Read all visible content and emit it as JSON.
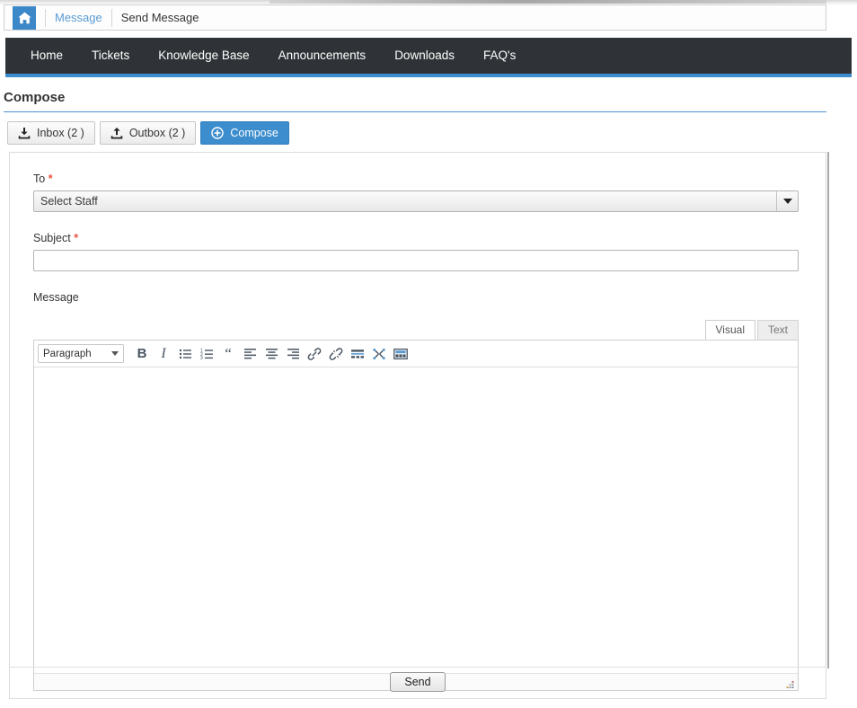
{
  "breadcrumb": {
    "home_icon": "home-icon",
    "link_label": "Message",
    "current_label": "Send Message"
  },
  "nav": {
    "items": [
      {
        "label": "Home"
      },
      {
        "label": "Tickets"
      },
      {
        "label": "Knowledge Base"
      },
      {
        "label": "Announcements"
      },
      {
        "label": "Downloads"
      },
      {
        "label": "FAQ's"
      }
    ],
    "background": "#2f3337",
    "accent": "#3c8dcd"
  },
  "page": {
    "title": "Compose"
  },
  "tabs": [
    {
      "label": "Inbox (2 )",
      "icon": "inbox-download-icon",
      "active": false
    },
    {
      "label": "Outbox (2 )",
      "icon": "outbox-upload-icon",
      "active": false
    },
    {
      "label": "Compose",
      "icon": "plus-circle-icon",
      "active": true
    }
  ],
  "form": {
    "to": {
      "label": "To",
      "required_mark": "*",
      "selected_option": "Select Staff",
      "options": [
        "Select Staff"
      ]
    },
    "subject": {
      "label": "Subject",
      "required_mark": "*",
      "value": "",
      "placeholder": ""
    },
    "message": {
      "label": "Message",
      "value": "",
      "editor_tabs": [
        {
          "label": "Visual",
          "active": true
        },
        {
          "label": "Text",
          "active": false
        }
      ],
      "toolbar": {
        "format_select": "Paragraph",
        "buttons": [
          {
            "name": "bold",
            "title": "Bold"
          },
          {
            "name": "italic",
            "title": "Italic"
          },
          {
            "name": "bulleted-list",
            "title": "Bulleted list"
          },
          {
            "name": "numbered-list",
            "title": "Numbered list"
          },
          {
            "name": "blockquote",
            "title": "Blockquote"
          },
          {
            "name": "align-left",
            "title": "Align left"
          },
          {
            "name": "align-center",
            "title": "Align center"
          },
          {
            "name": "align-right",
            "title": "Align right"
          },
          {
            "name": "insert-link",
            "title": "Insert/edit link"
          },
          {
            "name": "unlink",
            "title": "Remove link"
          },
          {
            "name": "insert-read-more",
            "title": "Insert Read More tag"
          },
          {
            "name": "fullscreen",
            "title": "Distraction-free writing mode"
          },
          {
            "name": "toolbar-toggle",
            "title": "Toolbar Toggle"
          }
        ]
      }
    },
    "submit_label": "Send"
  },
  "colors": {
    "accent_blue": "#3c8dcd",
    "nav_dark": "#2f3337",
    "required_red": "#e8543f",
    "link_blue": "#5a9bd4"
  }
}
